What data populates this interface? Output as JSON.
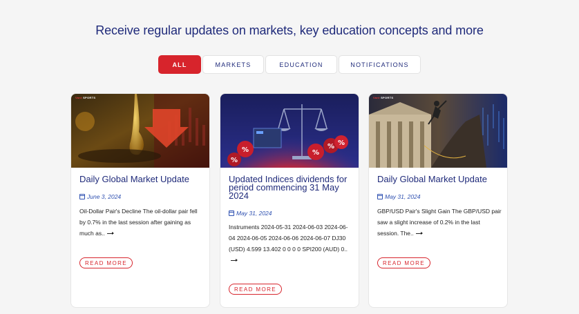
{
  "headline": "Receive regular updates on markets, key education concepts and more",
  "tabs": [
    {
      "label": "ALL",
      "active": true
    },
    {
      "label": "MARKETS",
      "active": false
    },
    {
      "label": "EDUCATION",
      "active": false
    },
    {
      "label": "NOTIFICATIONS",
      "active": false
    }
  ],
  "cards": [
    {
      "badge": "SPORTS",
      "badge_prefix": "Vant",
      "title": "Daily Global Market Update",
      "date": "June 3, 2024",
      "excerpt": "Oil-Dollar Pair's Decline The oil-dollar pair fell by 0.7% in the last session after gaining as much as..",
      "cta": "READ MORE",
      "image_icon": "oil-drop-down-arrow-image"
    },
    {
      "title": "Updated Indices dividends for period commencing 31 May 2024",
      "date": "May 31, 2024",
      "excerpt": "Instruments 2024-05-31 2024-06-03 2024-06-04 2024-06-05 2024-06-06 2024-06-07 DJ30 (USD) 4.599 13.402 0 0 0 0 SPI200 (AUD) 0..",
      "cta": "READ MORE",
      "image_icon": "scales-percent-image"
    },
    {
      "badge": "SPORTS",
      "badge_prefix": "Vant",
      "title": "Daily Global Market Update",
      "date": "May 31, 2024",
      "excerpt": "GBP/USD Pair's Slight Gain The GBP/USD pair saw a slight increase of 0.2% in the last session. The..",
      "cta": "READ MORE",
      "image_icon": "climber-building-image"
    }
  ],
  "colors": {
    "accent": "#d7242c",
    "heading": "#1f2a7a",
    "date": "#2d4fb0"
  }
}
